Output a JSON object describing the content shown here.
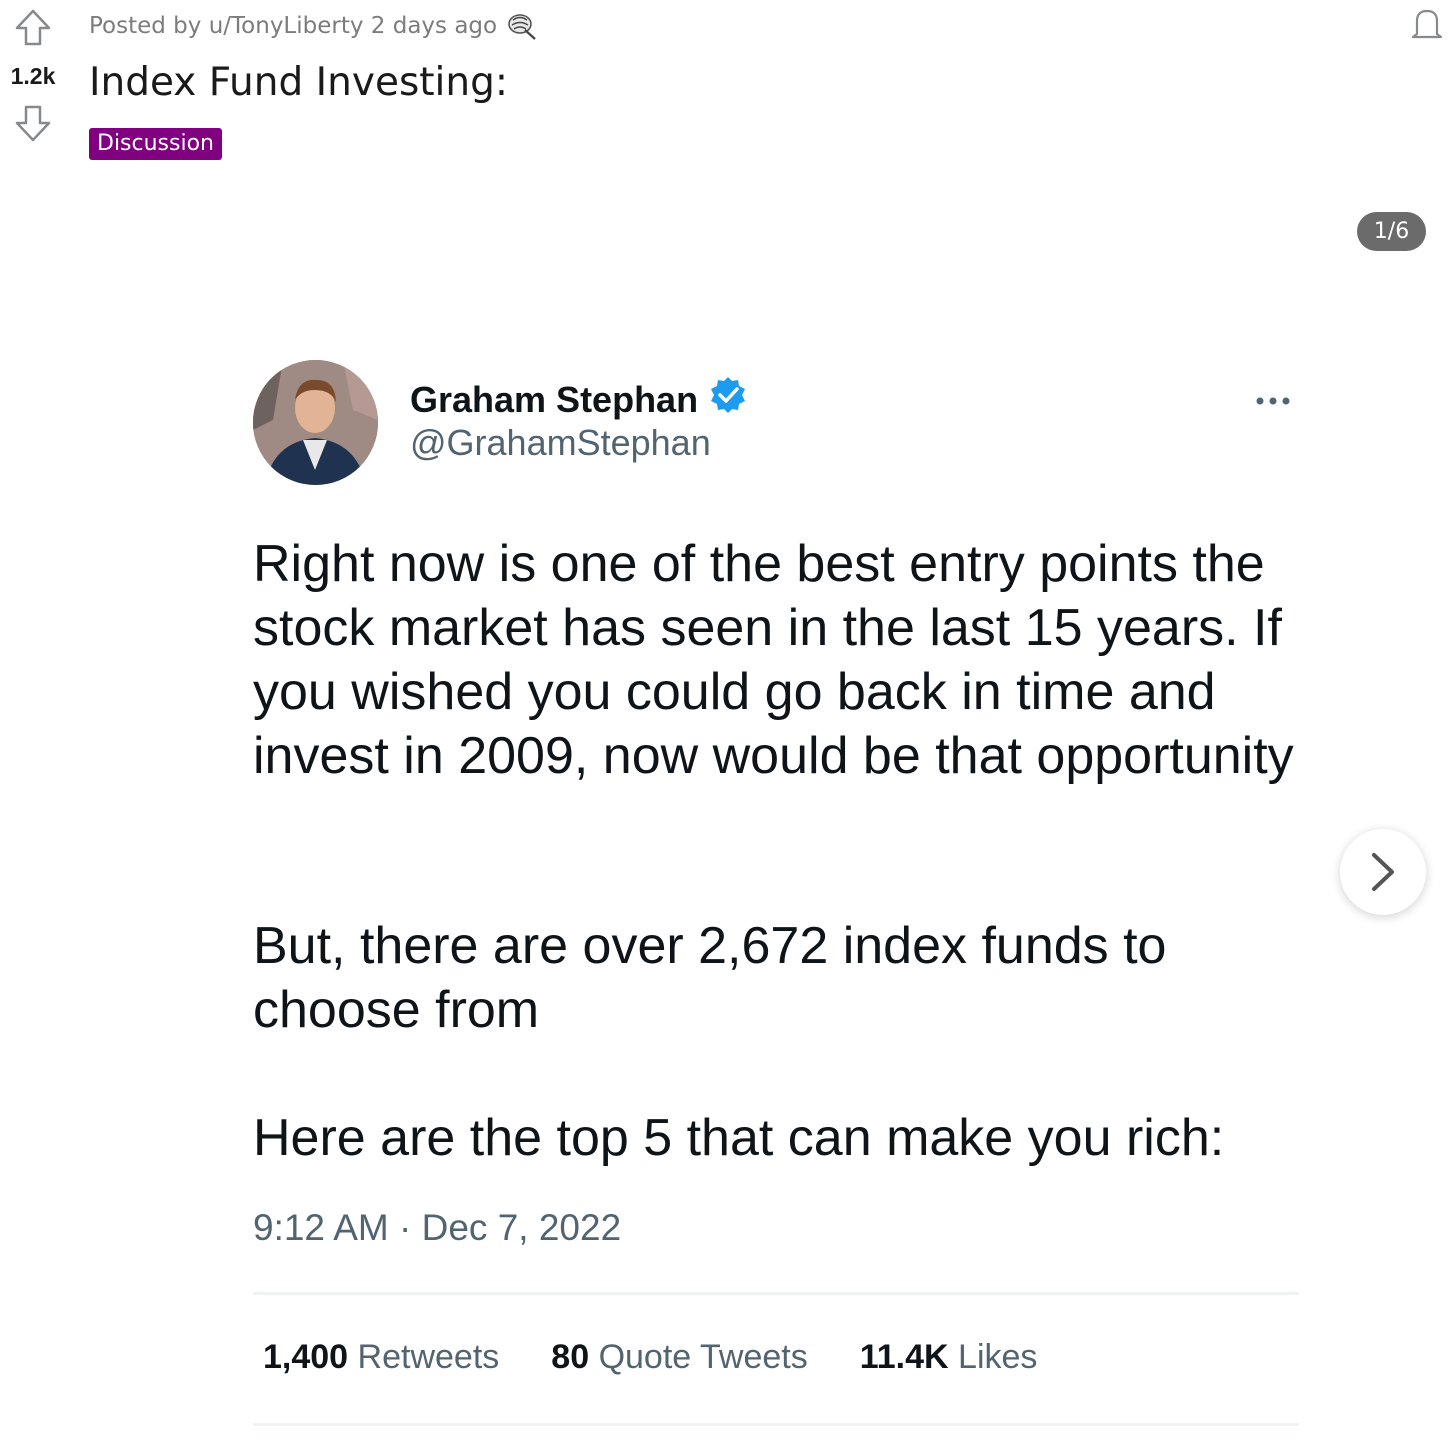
{
  "post": {
    "meta": "Posted by u/TonyLiberty 2 days ago",
    "vote_count": "1.2k",
    "title": "Index Fund Investing:",
    "flair": "Discussion",
    "gallery_counter": "1/6",
    "flair_color": "#800080"
  },
  "tweet": {
    "author_name": "Graham Stephan",
    "handle": "@GrahamStephan",
    "text_1": "Right now is one of the best entry points the stock market has seen in the last 15 years. If you wished you could go back in time and invest in 2009, now would be that opportunity",
    "text_2": "But, there are over 2,672 index funds to choose from",
    "text_3": "Here are the top 5 that can make you rich:",
    "timestamp": "9:12 AM · Dec 7, 2022",
    "stats": [
      {
        "value": "1,400",
        "label": "Retweets"
      },
      {
        "value": "80",
        "label": "Quote Tweets"
      },
      {
        "value": "11.4K",
        "label": "Likes"
      }
    ],
    "verified_color": "#1d9bf0"
  },
  "icons": [
    "upvote-icon",
    "downvote-icon",
    "award-icon",
    "bell-icon",
    "verified-badge-icon",
    "more-icon",
    "chevron-right-icon"
  ]
}
